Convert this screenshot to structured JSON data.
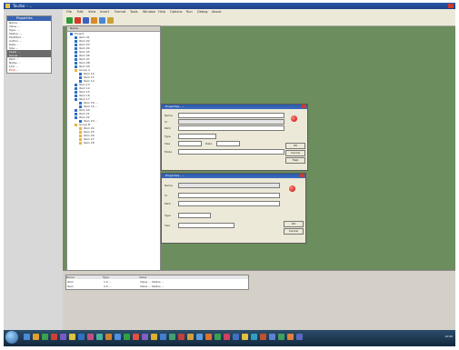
{
  "window": {
    "title": "Tourbo - ..."
  },
  "left_panel": {
    "title": "Properties",
    "rows": [
      "Name: ...",
      "Value ...",
      "Type: ...",
      "Status: ...",
      "Modified ...",
      "Author ...",
      "Date ...",
      "Size ...",
      "Level ...",
      "Owner ...",
      "Path ...",
      "Notes ...",
      "Link ...",
      "Error ..."
    ]
  },
  "menu": [
    "File",
    "Edit",
    "View",
    "Insert",
    "Format",
    "Tools",
    "Window",
    "Help",
    "Options",
    "Run",
    "Debug",
    "About"
  ],
  "tree": {
    "header": "Name",
    "items": [
      {
        "label": "Project",
        "indent": 0,
        "folder": false
      },
      {
        "label": "Item 01",
        "indent": 1,
        "folder": false
      },
      {
        "label": "Item 02",
        "indent": 1,
        "folder": false
      },
      {
        "label": "Item 03",
        "indent": 1,
        "folder": false
      },
      {
        "label": "Item 04",
        "indent": 1,
        "folder": false
      },
      {
        "label": "Item 05",
        "indent": 1,
        "folder": false
      },
      {
        "label": "Item 06",
        "indent": 1,
        "folder": false
      },
      {
        "label": "Item 07",
        "indent": 1,
        "folder": false
      },
      {
        "label": "Item 08",
        "indent": 1,
        "folder": false
      },
      {
        "label": "Item 09",
        "indent": 1,
        "folder": false
      },
      {
        "label": "Group A",
        "indent": 1,
        "folder": true
      },
      {
        "label": "Item 10",
        "indent": 2,
        "folder": false
      },
      {
        "label": "Item 11",
        "indent": 2,
        "folder": false
      },
      {
        "label": "Item 12",
        "indent": 2,
        "folder": false
      },
      {
        "label": "Item 13",
        "indent": 1,
        "folder": false
      },
      {
        "label": "Item 14",
        "indent": 1,
        "folder": false
      },
      {
        "label": "Item 15",
        "indent": 1,
        "folder": false
      },
      {
        "label": "Item 16",
        "indent": 1,
        "folder": false
      },
      {
        "label": "Item 17",
        "indent": 1,
        "folder": false
      },
      {
        "label": "Item 18 ...",
        "indent": 2,
        "folder": false
      },
      {
        "label": "Item 19 ...",
        "indent": 2,
        "folder": false
      },
      {
        "label": "Item 20",
        "indent": 1,
        "folder": false
      },
      {
        "label": "Item 21",
        "indent": 1,
        "folder": false
      },
      {
        "label": "Item 22",
        "indent": 1,
        "folder": false
      },
      {
        "label": "Item 23 ...",
        "indent": 2,
        "folder": false
      },
      {
        "label": "Group B",
        "indent": 1,
        "folder": true
      },
      {
        "label": "Item 24",
        "indent": 2,
        "folder": true
      },
      {
        "label": "Item 25",
        "indent": 2,
        "folder": true
      },
      {
        "label": "Item 26",
        "indent": 2,
        "folder": true
      },
      {
        "label": "Item 27",
        "indent": 2,
        "folder": true
      },
      {
        "label": "Item 28",
        "indent": 2,
        "folder": true
      }
    ]
  },
  "dialogs": [
    {
      "title": "Properties - ...",
      "labels": [
        "Name",
        "Id",
        "Path",
        "Type",
        "Size",
        "Date",
        "Mode"
      ],
      "buttons": [
        "OK",
        "Cancel",
        "Help"
      ]
    },
    {
      "title": "Properties - ...",
      "labels": [
        "Name",
        "Id",
        "Path",
        "Type",
        "Size"
      ],
      "buttons": [
        "OK",
        "Cancel"
      ]
    }
  ],
  "bottom_table": {
    "headers": [
      "Name",
      "Type",
      "Value"
    ],
    "rows": [
      [
        "Item",
        "1.0 ...",
        "Value ... Status ..."
      ],
      [
        "Item",
        "2.0 ...",
        "Value ... Status ..."
      ]
    ]
  },
  "taskbar": {
    "clock": "12:00"
  }
}
